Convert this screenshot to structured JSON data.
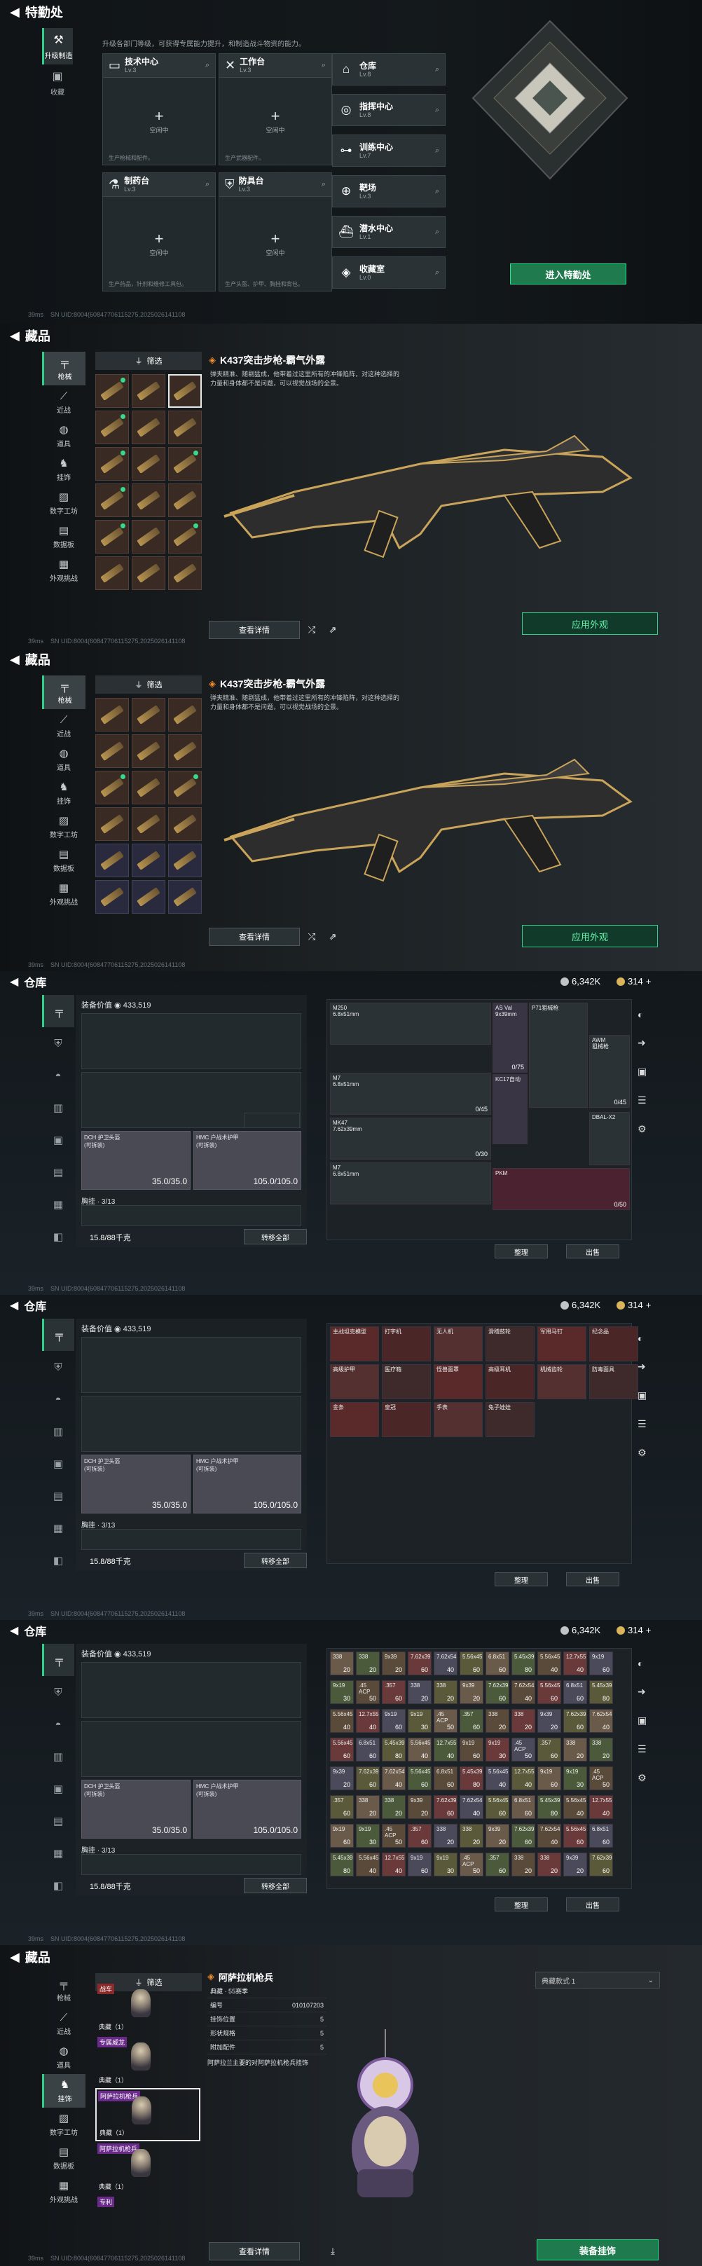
{
  "hq": {
    "title": "特勤处",
    "side_tabs": [
      {
        "label": "升级制造",
        "icon": "wrench-icon"
      },
      {
        "label": "收藏",
        "icon": "box-icon"
      }
    ],
    "description": "升级各部门等级，可获得专属能力提升，和制造战斗物资的能力。",
    "facilities": [
      {
        "name": "技术中心",
        "level": "Lv.3",
        "idle": "空闲中",
        "note": "生产枪械和配件。"
      },
      {
        "name": "工作台",
        "level": "Lv.3",
        "idle": "空闲中",
        "note": "生产武器配件。"
      },
      {
        "name": "制药台",
        "level": "Lv.3",
        "idle": "空闲中",
        "note": "生产药品，针剂和维修工具包。"
      },
      {
        "name": "防具台",
        "level": "Lv.3",
        "idle": "空闲中",
        "note": "生产头盔、护甲、胸挂和背包。"
      }
    ],
    "rooms": [
      {
        "name": "仓库",
        "level": "Lv.8"
      },
      {
        "name": "指挥中心",
        "level": "Lv.8"
      },
      {
        "name": "训练中心",
        "level": "Lv.7"
      },
      {
        "name": "靶场",
        "level": "Lv.3"
      },
      {
        "name": "潜水中心",
        "level": "Lv.1"
      },
      {
        "name": "收藏室",
        "level": "Lv.0"
      }
    ],
    "enter_label": "进入特勤处",
    "ping": "39ms",
    "uid": "SN UID:8004(60847706115275,2025026141108"
  },
  "collection": {
    "title": "藏品",
    "nav": [
      "枪械",
      "近战",
      "道具",
      "挂饰",
      "数字工坊",
      "数据板",
      "外观挑战"
    ],
    "filter_label": "筛选",
    "skin_tag": "K437",
    "skin_name": "K437突击步枪-霸气外露",
    "skin_desc": "弹夹精准、随剔猛成，他带着过这里所有的冲锋陷阵，对这种选择的力量和身体都不是问题，可以视觉战场的全景。",
    "detail_label": "查看详情",
    "apply_label": "应用外观",
    "ping": "39ms",
    "uid": "SN UID:8004(60847706115275,2025026141108"
  },
  "warehouse": {
    "title": "仓库",
    "money": "6,342K",
    "coupons": "314",
    "plus": "+",
    "equip_value_label": "装备价值",
    "equip_value": "433,519",
    "helmet_name": "DCH 护卫头盔",
    "helmet_sub": "(可拆装)",
    "helmet_dur": "35.0/35.0",
    "armor_name": "HMC 户战术护甲",
    "armor_sub": "(可拆装)",
    "armor_dur": "105.0/105.0",
    "backpack": "胸挂 · 3/13",
    "capacity": "15.8/88千克",
    "transfer_label": "转移全部",
    "sort_label": "整理",
    "sell_label": "出售",
    "stash1": [
      {
        "name": "M250",
        "sub": "6.8x51mm",
        "count": ""
      },
      {
        "name": "AS Val",
        "sub": "9x39mm",
        "count": "0/75"
      },
      {
        "name": "P71狙械枪",
        "sub": "",
        "count": ""
      },
      {
        "name": "M7",
        "sub": "6.8x51mm",
        "count": "0/45"
      },
      {
        "name": "KC17自动",
        "sub": "",
        "count": ""
      },
      {
        "name": "AWM",
        "sub": "狙械枪",
        "count": "0/45"
      },
      {
        "name": "MK47",
        "sub": "7.62x39mm",
        "count": "0/30"
      },
      {
        "name": "M7",
        "sub": "6.8x51mm",
        "count": ""
      },
      {
        "name": "PKM",
        "sub": "",
        "count": "0/50"
      },
      {
        "name": "DBAL-X2",
        "sub": "",
        "count": ""
      }
    ],
    "stash2": [
      "主战坦克模型",
      "打字机",
      "无人机",
      "滑稽鼓轮",
      "军用马钉",
      "纪念品",
      "高级护甲",
      "医疗箱",
      "怪兽面罩",
      "高级耳机",
      "机械齿轮",
      "防毒面具",
      "金条",
      "皇冠",
      "手表",
      "兔子娃娃"
    ],
    "ammo": [
      "338",
      "338",
      "9x39",
      "7.62x39",
      "7.62x54",
      "5.56x45",
      "6.8x51",
      "5.45x39",
      "5.56x45",
      "12.7x55",
      "9x19",
      "9x19",
      ".45 ACP",
      ".357"
    ],
    "ammo_counts": [
      "20",
      "20",
      "20",
      "60",
      "40",
      "60",
      "60",
      "80",
      "40",
      "40",
      "60",
      "30",
      "50",
      "60"
    ],
    "ping": "39ms",
    "uid": "SN UID:8004(60847706115275,2025026141108"
  },
  "charm": {
    "title": "藏品",
    "nav": [
      "枪械",
      "近战",
      "道具",
      "挂饰",
      "数字工坊",
      "数据板",
      "外观挑战"
    ],
    "filter_label": "筛选",
    "selected_name": "阿萨拉机枪兵",
    "chars": [
      {
        "tag": "战车",
        "own": "典藏（1）"
      },
      {
        "tag": "专属威龙",
        "own": "典藏（1）"
      },
      {
        "tag": "阿萨拉机枪兵",
        "own": "典藏（1）"
      },
      {
        "tag": "阿萨拉机枪兵",
        "own": "典藏（1）"
      },
      {
        "tag": "专利",
        "own": ""
      }
    ],
    "info": [
      {
        "k": "典藏 · 55赛季",
        "v": ""
      },
      {
        "k": "编号",
        "v": "010107203"
      },
      {
        "k": "挂饰位置",
        "v": "5"
      },
      {
        "k": "形状规格",
        "v": "5"
      },
      {
        "k": "附加配件",
        "v": "5"
      }
    ],
    "info_note": "阿萨拉兰主要的对阿萨拉机枪兵挂饰",
    "dropdown": "典藏款式 1",
    "detail_label": "查看详情",
    "deploy_label": "装备挂饰",
    "ping": "39ms",
    "uid": "SN UID:8004(60847706115275,2025026141108"
  },
  "colors": {
    "accent": "#2fd08a",
    "orange": "#f08a2b",
    "gold": "#c9a45a"
  }
}
